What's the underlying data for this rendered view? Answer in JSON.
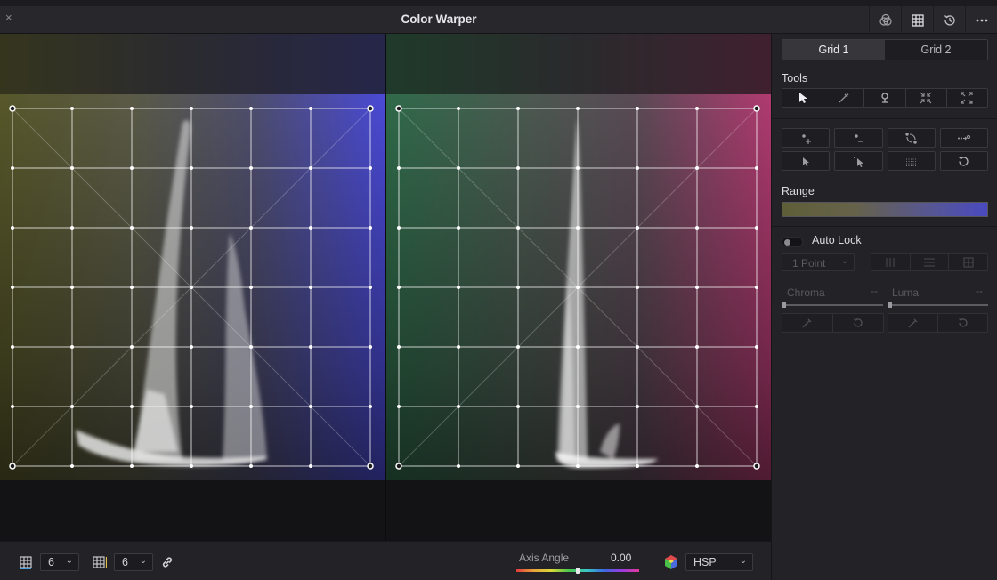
{
  "window": {
    "title": "Color Warper",
    "close_label": "×"
  },
  "inspector": {
    "tabs": [
      {
        "label": "Grid 1",
        "active": true
      },
      {
        "label": "Grid 2",
        "active": false
      }
    ],
    "tools_label": "Tools",
    "range_label": "Range",
    "auto_lock_label": "Auto Lock",
    "auto_lock_on": false,
    "lock_points_value": "1 Point",
    "chroma_label": "Chroma",
    "chroma_value": "--",
    "luma_label": "Luma",
    "luma_value": "--"
  },
  "bottombar": {
    "grid_columns_value": "6",
    "grid_rows_value": "6",
    "axis_angle_label": "Axis Angle",
    "axis_angle_value": "0.00",
    "color_space_value": "HSP"
  },
  "colors": {
    "left_panel_top_left": "#5a5a2c",
    "left_panel_top_right": "#4444c8",
    "right_panel_top_left": "#2e6a48",
    "right_panel_top_right": "#b0386c"
  }
}
